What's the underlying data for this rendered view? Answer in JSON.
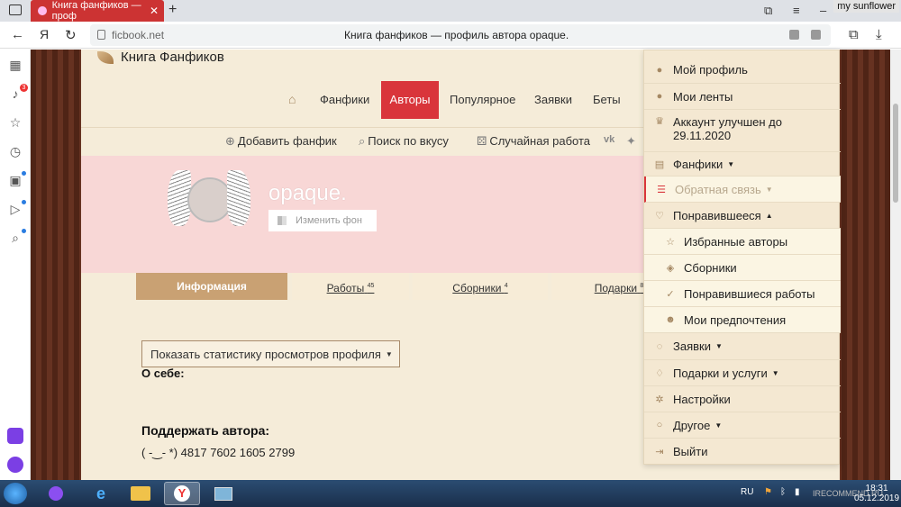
{
  "browser": {
    "tab_title": "Книга фанфиков — проф",
    "user_label": "my sunflower",
    "host": "ficbook.net",
    "page_title": "Книга фанфиков — профиль автора opaque.",
    "home_glyph": "Я"
  },
  "site": {
    "brand": "Книга Фанфиков",
    "nav": {
      "fanfics": "Фанфики",
      "authors": "Авторы",
      "popular": "Популярное",
      "requests": "Заявки",
      "betas": "Беты"
    },
    "subnav": {
      "add_fanfic": "Добавить фанфик",
      "search_by_taste": "Поиск по вкусу",
      "random_work": "Случайная работа"
    }
  },
  "profile": {
    "username": "opaque.",
    "change_bg": "Изменить фон",
    "tabs": [
      {
        "label": "Информация",
        "count": ""
      },
      {
        "label": "Работы",
        "count": "45"
      },
      {
        "label": "Сборники",
        "count": "4"
      },
      {
        "label": "Подарки",
        "count": "8"
      }
    ],
    "stats_button": "Показать статистику просмотров профиля",
    "about_heading": "О себе:",
    "support_heading": "Поддержать автора:",
    "support_text": "( -‿- *) 4817 7602 1605 2799"
  },
  "menu": {
    "my_profile": "Мой профиль",
    "my_feeds": "Мои ленты",
    "account_upgraded": "Аккаунт улучшен до",
    "account_date": "29.11.2020",
    "fanfics": "Фанфики",
    "feedback": "Обратная связь",
    "liked": "Понравившееся",
    "favorite_authors": "Избранные авторы",
    "collections": "Сборники",
    "liked_works": "Понравившиеся работы",
    "my_preferences": "Мои предпочтения",
    "requests": "Заявки",
    "gifts_services": "Подарки и услуги",
    "settings": "Настройки",
    "other": "Другое",
    "logout": "Выйти"
  },
  "taskbar": {
    "lang": "RU",
    "time": "18:31",
    "date": "05.12.2019",
    "watermark": "IRECOMMEND.RU"
  },
  "colors": {
    "accent_red": "#d9353b",
    "page_bg": "#f5ecd9",
    "hero_pink": "#f8d7d6",
    "tab_active": "#c9a173"
  }
}
